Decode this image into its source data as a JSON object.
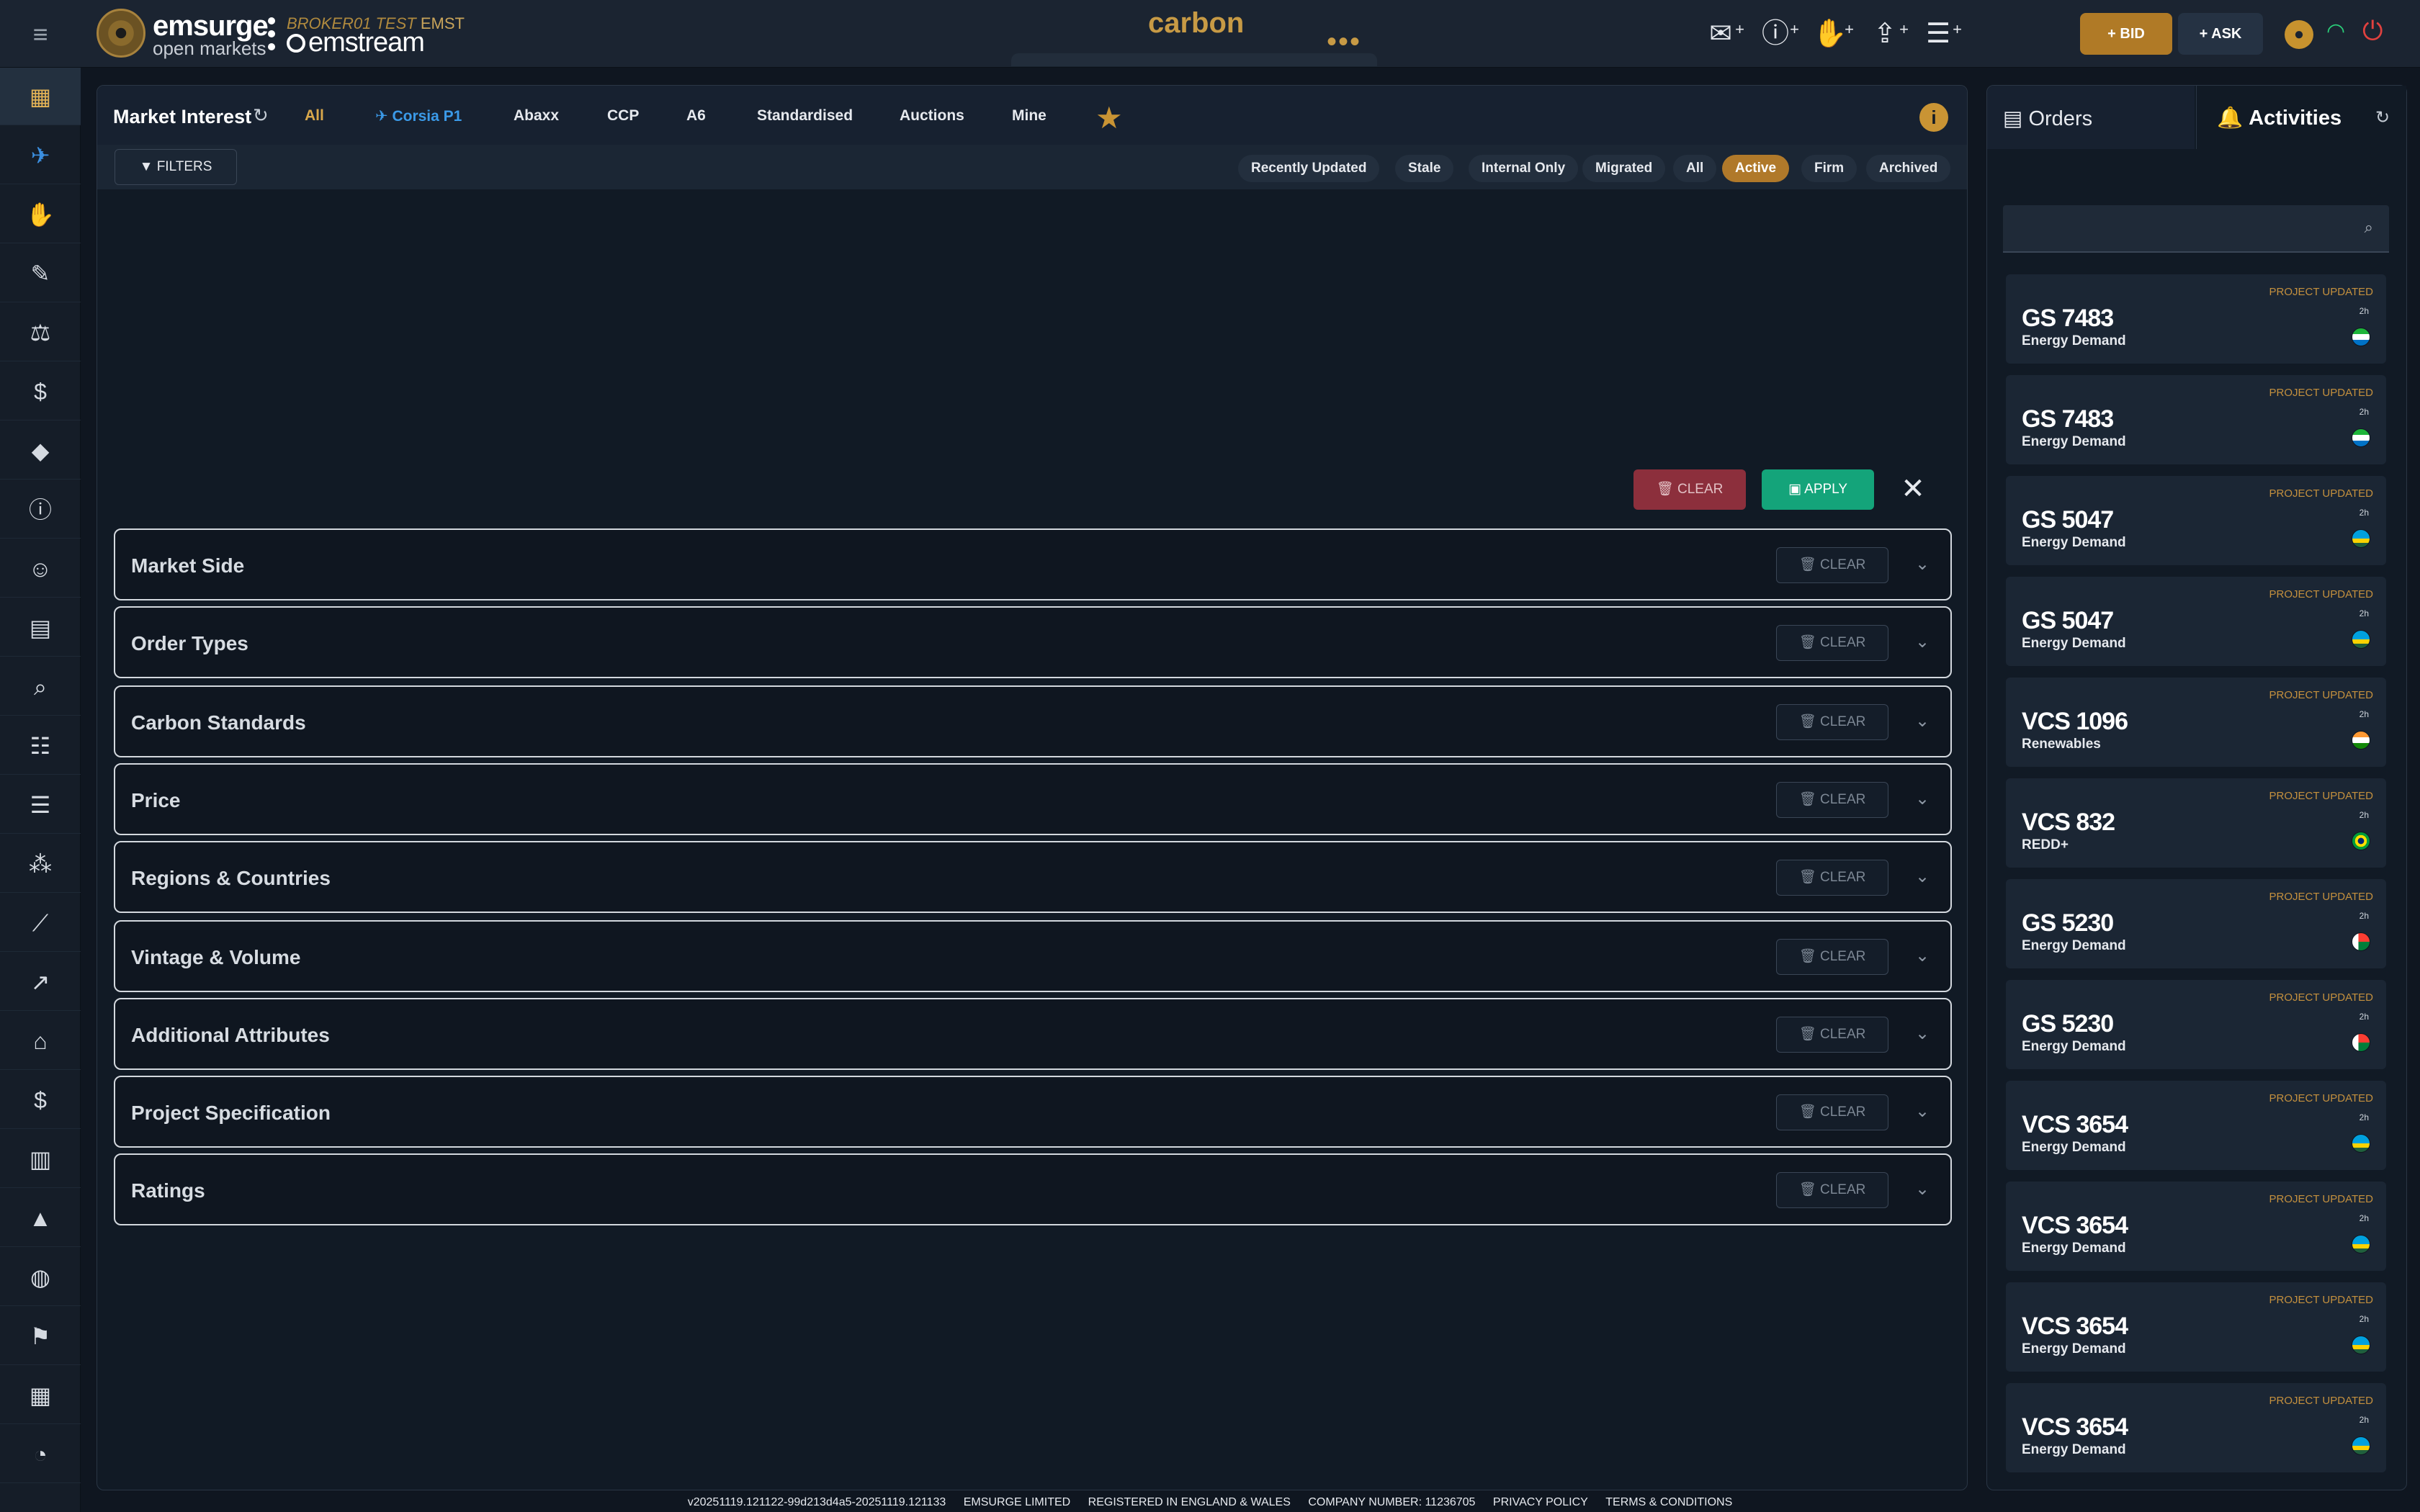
{
  "header": {
    "logo_main": "emsurge",
    "logo_sub": "open markets",
    "broker_name": "BROKER01 TEST",
    "broker_code": "EMST",
    "product": "emstream",
    "market": "carbon",
    "more": "•••",
    "bid_label": "+ BID",
    "ask_label": "+ ASK"
  },
  "market_interest": {
    "title": "Market Interest",
    "tabs": [
      "All",
      "Corsia P1",
      "Abaxx",
      "CCP",
      "A6",
      "Standardised",
      "Auctions",
      "Mine"
    ],
    "filters_label": "FILTERS",
    "status_pills": [
      "Recently Updated",
      "Stale",
      "Internal Only",
      "Migrated",
      "All",
      "Active",
      "Firm",
      "Archived"
    ],
    "active_pill": "Active"
  },
  "filter_panel": {
    "clear_label": "CLEAR",
    "apply_label": "APPLY",
    "section_clear_label": "CLEAR",
    "sections": [
      "Market Side",
      "Order Types",
      "Carbon Standards",
      "Price",
      "Regions & Countries",
      "Vintage & Volume",
      "Additional Attributes",
      "Project Specification",
      "Ratings"
    ]
  },
  "right_panel": {
    "orders_tab": "Orders",
    "activities_tab": "Activities",
    "search_placeholder": "",
    "activities": [
      {
        "status": "PROJECT UPDATED",
        "code": "GS 7483",
        "category": "Energy Demand",
        "time": "2h",
        "flag": "sierra-leone"
      },
      {
        "status": "PROJECT UPDATED",
        "code": "GS 7483",
        "category": "Energy Demand",
        "time": "2h",
        "flag": "sierra-leone"
      },
      {
        "status": "PROJECT UPDATED",
        "code": "GS 5047",
        "category": "Energy Demand",
        "time": "2h",
        "flag": "rwanda"
      },
      {
        "status": "PROJECT UPDATED",
        "code": "GS 5047",
        "category": "Energy Demand",
        "time": "2h",
        "flag": "rwanda"
      },
      {
        "status": "PROJECT UPDATED",
        "code": "VCS 1096",
        "category": "Renewables",
        "time": "2h",
        "flag": "india"
      },
      {
        "status": "PROJECT UPDATED",
        "code": "VCS 832",
        "category": "REDD+",
        "time": "2h",
        "flag": "brazil"
      },
      {
        "status": "PROJECT UPDATED",
        "code": "GS 5230",
        "category": "Energy Demand",
        "time": "2h",
        "flag": "madagascar"
      },
      {
        "status": "PROJECT UPDATED",
        "code": "GS 5230",
        "category": "Energy Demand",
        "time": "2h",
        "flag": "madagascar"
      },
      {
        "status": "PROJECT UPDATED",
        "code": "VCS 3654",
        "category": "Energy Demand",
        "time": "2h",
        "flag": "rwanda"
      },
      {
        "status": "PROJECT UPDATED",
        "code": "VCS 3654",
        "category": "Energy Demand",
        "time": "2h",
        "flag": "rwanda"
      },
      {
        "status": "PROJECT UPDATED",
        "code": "VCS 3654",
        "category": "Energy Demand",
        "time": "2h",
        "flag": "rwanda"
      },
      {
        "status": "PROJECT UPDATED",
        "code": "VCS 3654",
        "category": "Energy Demand",
        "time": "2h",
        "flag": "rwanda"
      }
    ]
  },
  "footer": {
    "version": "v20251119.121122-99d213d4a5-20251119.121133",
    "company": "EMSURGE LIMITED",
    "registered": "REGISTERED IN ENGLAND & WALES",
    "company_number": "COMPANY NUMBER: 11236705",
    "privacy": "PRIVACY POLICY",
    "terms": "TERMS & CONDITIONS"
  },
  "colors": {
    "accent_gold": "#c99434",
    "active_blue": "#3b9ae8",
    "apply_green": "#14a47a",
    "clear_red": "#8c2f3c"
  }
}
